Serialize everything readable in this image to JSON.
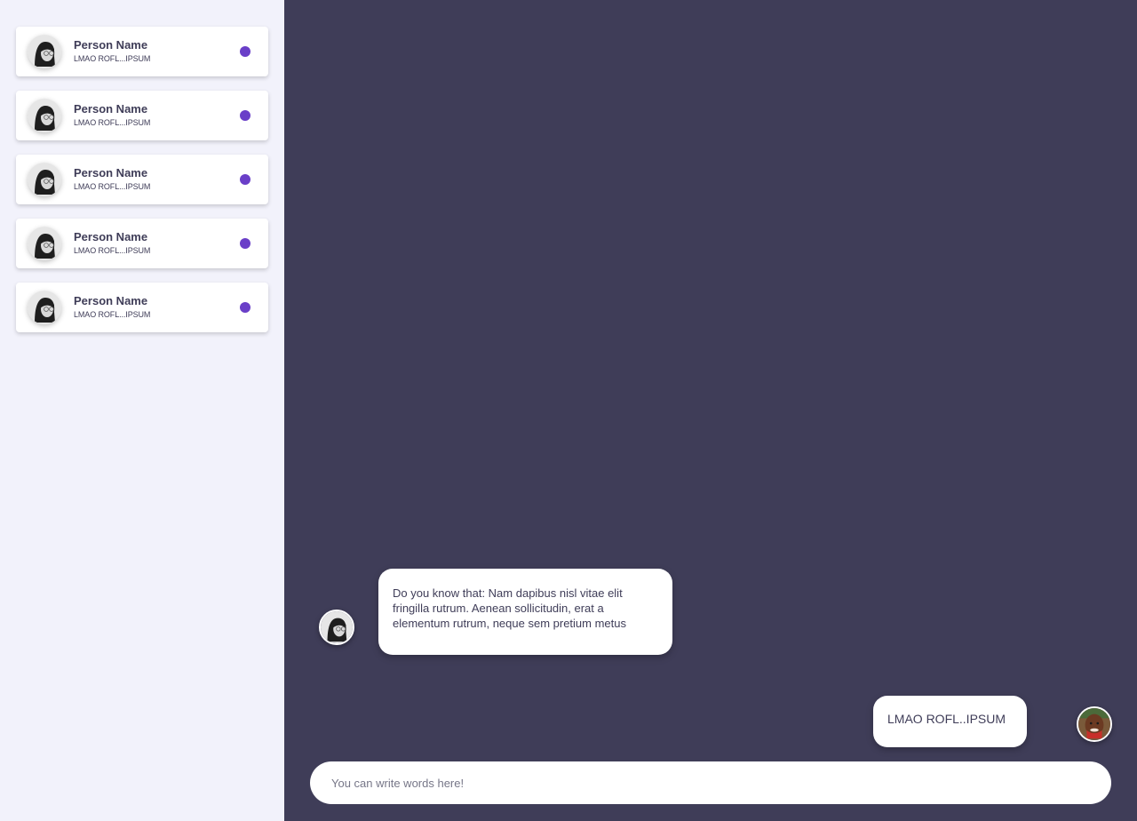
{
  "colors": {
    "sidebar_bg": "#f2f2fb",
    "chat_bg": "#3f3d58",
    "text_dark": "#3f3d58",
    "status_dot": "#6a3fc8"
  },
  "sidebar": {
    "contacts": [
      {
        "name": "Person Name",
        "preview": "LMAO ROFL...IPSUM",
        "avatar": "person-avatar-icon",
        "unread": true
      },
      {
        "name": "Person Name",
        "preview": "LMAO ROFL...IPSUM",
        "avatar": "person-avatar-icon",
        "unread": true
      },
      {
        "name": "Person Name",
        "preview": "LMAO ROFL...IPSUM",
        "avatar": "person-avatar-icon",
        "unread": true
      },
      {
        "name": "Person Name",
        "preview": "LMAO ROFL...IPSUM",
        "avatar": "person-avatar-icon",
        "unread": true
      },
      {
        "name": "Person Name",
        "preview": "LMAO ROFL...IPSUM",
        "avatar": "person-avatar-icon",
        "unread": true
      }
    ]
  },
  "chat": {
    "messages": [
      {
        "direction": "incoming",
        "text": "Do you know that: Nam dapibus nisl vitae elit fringilla rutrum. Aenean sollicitudin, erat a elementum rutrum, neque sem pretium metus",
        "avatar": "contact-avatar-icon"
      },
      {
        "direction": "outgoing",
        "text": "LMAO ROFL..IPSUM",
        "avatar": "user-avatar-icon"
      }
    ],
    "composer": {
      "placeholder": "You can write words here!",
      "value": ""
    }
  }
}
